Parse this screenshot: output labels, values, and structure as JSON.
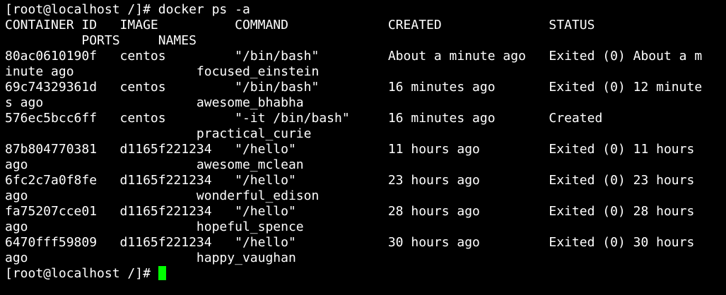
{
  "terminal": {
    "cursor_color": "#00ff00",
    "background_color": "#000000",
    "text_color": "#ffffff",
    "lines": [
      "[root@localhost /]# docker ps -a",
      "CONTAINER ID   IMAGE          COMMAND             CREATED              STATUS",
      "          PORTS     NAMES",
      "80ac0610190f   centos         \"/bin/bash\"         About a minute ago   Exited (0) About a m",
      "inute ago                focused_einstein",
      "69c74329361d   centos         \"/bin/bash\"         16 minutes ago       Exited (0) 12 minute",
      "s ago                    awesome_bhabha",
      "576ec5bcc6ff   centos         \"-it /bin/bash\"     16 minutes ago       Created",
      "                         practical_curie",
      "87b804770381   d1165f221234   \"/hello\"            11 hours ago         Exited (0) 11 hours",
      "ago                      awesome_mclean",
      "6fc2c7a0f8fe   d1165f221234   \"/hello\"            23 hours ago         Exited (0) 23 hours",
      "ago                      wonderful_edison",
      "fa75207cce01   d1165f221234   \"/hello\"            28 hours ago         Exited (0) 28 hours",
      "ago                      hopeful_spence",
      "6470fff59809   d1165f221234   \"/hello\"            30 hours ago         Exited (0) 30 hours",
      "ago                      happy_vaughan"
    ],
    "prompt": "[root@localhost /]# "
  }
}
